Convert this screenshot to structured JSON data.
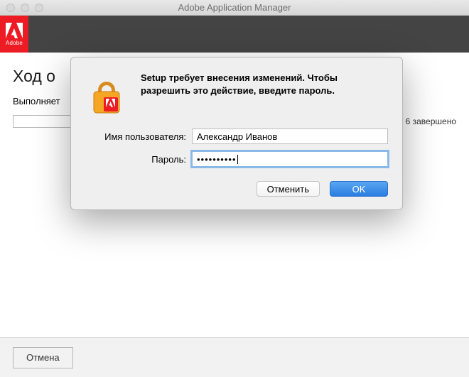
{
  "window": {
    "title": "Adobe Application Manager"
  },
  "logo": {
    "word": "Adobe"
  },
  "page": {
    "title": "Ход о",
    "subtext": "Выполняет",
    "progress_status": "6 завершено"
  },
  "bottom": {
    "cancel": "Отмена"
  },
  "modal": {
    "message": "Setup требует внесения изменений. Чтобы разрешить это действие, введите пароль.",
    "username_label": "Имя пользователя:",
    "username_value": "Александр Иванов",
    "password_label": "Пароль:",
    "password_value": "••••••••••",
    "cancel": "Отменить",
    "ok": "OK"
  }
}
